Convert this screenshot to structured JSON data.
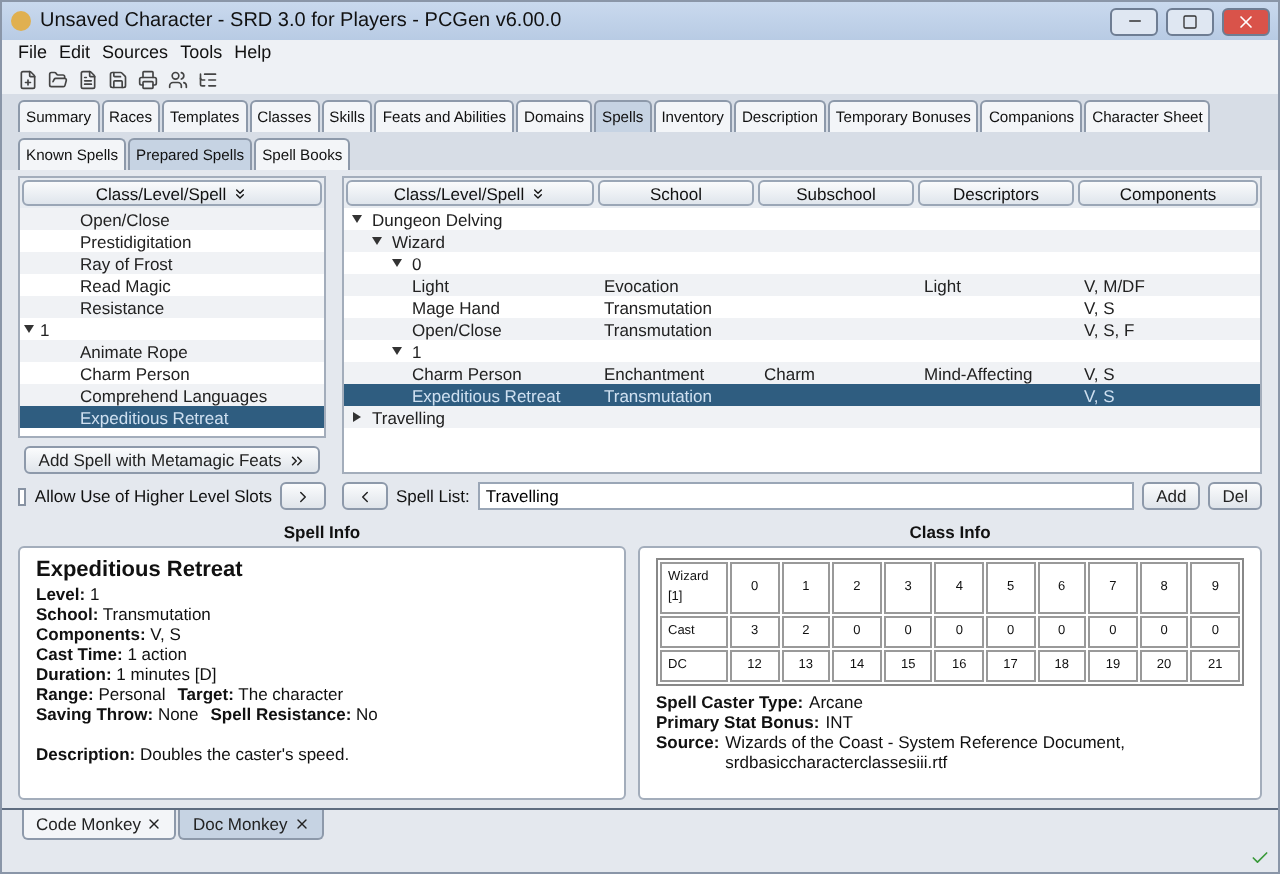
{
  "window": {
    "title": "Unsaved Character - SRD 3.0 for Players - PCGen v6.00.0"
  },
  "menu": [
    "File",
    "Edit",
    "Sources",
    "Tools",
    "Help"
  ],
  "tabs": [
    {
      "label": "Summary",
      "selected": false
    },
    {
      "label": "Races",
      "selected": false
    },
    {
      "label": "Templates",
      "selected": false
    },
    {
      "label": "Classes",
      "selected": false
    },
    {
      "label": "Skills",
      "selected": false
    },
    {
      "label": "Feats and Abilities",
      "selected": false
    },
    {
      "label": "Domains",
      "selected": false
    },
    {
      "label": "Spells",
      "selected": true
    },
    {
      "label": "Inventory",
      "selected": false
    },
    {
      "label": "Description",
      "selected": false
    },
    {
      "label": "Temporary Bonuses",
      "selected": false
    },
    {
      "label": "Companions",
      "selected": false
    },
    {
      "label": "Character Sheet",
      "selected": false
    }
  ],
  "subtabs": [
    {
      "label": "Known Spells",
      "selected": false
    },
    {
      "label": "Prepared Spells",
      "selected": true
    },
    {
      "label": "Spell Books",
      "selected": false
    }
  ],
  "available": {
    "column": "Class/Level/Spell",
    "nodes": [
      {
        "label": "Open/Close",
        "selected": false
      },
      {
        "label": "Prestidigitation",
        "selected": false
      },
      {
        "label": "Ray of Frost",
        "selected": false
      },
      {
        "label": "Read Magic",
        "selected": false
      },
      {
        "label": "Resistance",
        "selected": false
      },
      {
        "label": "1",
        "selected": false,
        "expanded": true,
        "children": [
          {
            "label": "Animate Rope",
            "selected": false
          },
          {
            "label": "Charm Person",
            "selected": false
          },
          {
            "label": "Comprehend Languages",
            "selected": false
          },
          {
            "label": "Expeditious Retreat",
            "selected": true
          }
        ]
      }
    ],
    "metamagic_button": "Add Spell with Metamagic Feats",
    "higher_slots": {
      "label": "Allow Use of Higher Level Slots",
      "checked": false
    }
  },
  "prepared": {
    "columns": [
      "Class/Level/Spell",
      "School",
      "Subschool",
      "Descriptors",
      "Components"
    ],
    "nodes": [
      {
        "label": "Dungeon Delving",
        "selected": false,
        "expanded": true,
        "children": [
          {
            "label": "Wizard",
            "selected": false,
            "expanded": true,
            "children": [
              {
                "label": "0",
                "selected": false,
                "expanded": true,
                "children": [
                  {
                    "label": "Light",
                    "selected": false,
                    "school": "Evocation",
                    "descriptors": "Light",
                    "components": "V, M/DF"
                  },
                  {
                    "label": "Mage Hand",
                    "selected": false,
                    "school": "Transmutation",
                    "components": "V, S"
                  },
                  {
                    "label": "Open/Close",
                    "selected": false,
                    "school": "Transmutation",
                    "components": "V, S, F"
                  }
                ]
              },
              {
                "label": "1",
                "selected": false,
                "expanded": true,
                "children": [
                  {
                    "label": "Charm Person",
                    "selected": false,
                    "school": "Enchantment",
                    "subschool": "Charm",
                    "descriptors": "Mind-Affecting",
                    "components": "V, S"
                  },
                  {
                    "label": "Expeditious Retreat",
                    "selected": true,
                    "school": "Transmutation",
                    "components": "V, S"
                  }
                ]
              }
            ]
          }
        ]
      },
      {
        "label": "Travelling",
        "selected": false,
        "expanded": false
      }
    ],
    "spell_list_label": "Spell List:",
    "spell_list_value": "Travelling",
    "buttons": [
      "Add",
      "Del"
    ]
  },
  "spell_info": {
    "heading": "Spell Info",
    "title": "Expeditious Retreat",
    "lines": [
      [
        {
          "label": "Level:",
          "value": "1"
        }
      ],
      [
        {
          "label": "School:",
          "value": "Transmutation"
        }
      ],
      [
        {
          "label": "Components:",
          "value": "V, S"
        }
      ],
      [
        {
          "label": "Cast Time:",
          "value": "1 action"
        }
      ],
      [
        {
          "label": "Duration:",
          "value": "1 minutes [D]"
        }
      ],
      [
        {
          "label": "Range:",
          "value": "Personal"
        },
        {
          "label": "Target:",
          "value": "The character"
        }
      ],
      [
        {
          "label": "Saving Throw:",
          "value": "None"
        },
        {
          "label": "Spell Resistance:",
          "value": "No"
        }
      ]
    ],
    "description": {
      "label": "Description:",
      "value": "Doubles the caster's speed."
    }
  },
  "class_info": {
    "heading": "Class Info",
    "table": [
      [
        "Wizard [1]",
        "0",
        "1",
        "2",
        "3",
        "4",
        "5",
        "6",
        "7",
        "8",
        "9"
      ],
      [
        "Cast",
        "3",
        "2",
        "0",
        "0",
        "0",
        "0",
        "0",
        "0",
        "0",
        "0"
      ],
      [
        "DC",
        "12",
        "13",
        "14",
        "15",
        "16",
        "17",
        "18",
        "19",
        "20",
        "21"
      ]
    ],
    "lines": [
      {
        "label": "Spell Caster Type:",
        "value": "Arcane"
      },
      {
        "label": "Primary Stat Bonus:",
        "value": "INT"
      },
      {
        "label": "Source:",
        "value": "Wizards of the Coast - System Reference Document, srdbasiccharacterclassesiii.rtf"
      }
    ]
  },
  "character_tabs": [
    {
      "label": "Code Monkey",
      "selected": false
    },
    {
      "label": "Doc Monkey",
      "selected": true
    }
  ]
}
